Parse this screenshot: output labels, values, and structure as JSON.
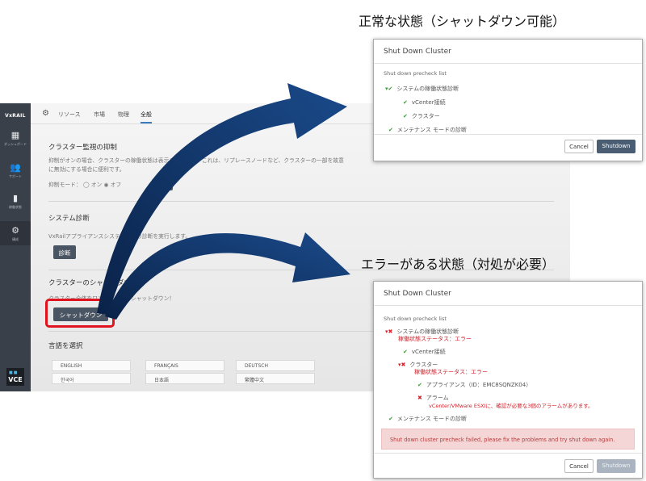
{
  "headings": {
    "normal": "正常な状態（シャットダウン可能）",
    "error": "エラーがある状態（対処が必要）"
  },
  "sidebar": {
    "logo": "VxRAIL",
    "items": [
      {
        "icon": "dashboard-icon",
        "label": "ダッシュボード"
      },
      {
        "icon": "support-icon",
        "label": "サポート"
      },
      {
        "icon": "health-icon",
        "label": "稼働状態"
      },
      {
        "icon": "config-icon",
        "label": "構成"
      }
    ],
    "vce": "VCE"
  },
  "tabs": [
    "リソース",
    "市場",
    "物理",
    "全般"
  ],
  "sections": {
    "suppress": {
      "title": "クラスター監視の抑制",
      "text": "抑制がオンの場合、クラスターの稼働状態は表示されません。これは、リプレースノードなど、クラスターの一部を故意",
      "text2": "に無効にする場合に便利です。",
      "mode_label": "抑制モード：",
      "on": "オン",
      "off": "オフ",
      "apply": "適用"
    },
    "diagnosis": {
      "title": "システム診断",
      "text": "VxRailアプライアンスシステム全体の診断を実行します。",
      "button": "診断"
    },
    "shutdown": {
      "title": "クラスターのシャットダウン",
      "text": "クラスター全体をワンクリックでシャットダウン！",
      "button": "シャットダウン"
    },
    "language": {
      "title": "言語を選択",
      "options": [
        "ENGLISH",
        "FRANÇAIS",
        "DEUTSCH",
        "한국어",
        "日本語",
        "繁體中文"
      ]
    }
  },
  "dialog_ok": {
    "title": "Shut Down Cluster",
    "precheck_label": "Shut down precheck list",
    "rows": [
      "システムの稼働状態診断",
      "vCenter接続",
      "クラスター",
      "メンテナンス モードの診断"
    ],
    "cancel": "Cancel",
    "shutdown": "Shutdown"
  },
  "dialog_err": {
    "title": "Shut Down Cluster",
    "precheck_label": "Shut down precheck list",
    "system_health": "システムの稼働状態診断",
    "system_health_status": "稼働状態ステータス：エラー",
    "vcenter": "vCenter接続",
    "cluster": "クラスター",
    "cluster_status": "稼働状態ステータス：エラー",
    "appliance": "アプライアンス（ID：EMC8SQNZK04）",
    "alarm": "アラーム",
    "alarm_detail": "vCenter/VMware ESXIに、確認が必要な3個のアラームがあります。",
    "maintenance": "メンテナンス モードの診断",
    "alert": "Shut down cluster precheck failed, please fix the problems and try shut down again.",
    "cancel": "Cancel",
    "shutdown": "Shutdown"
  },
  "colors": {
    "ok": "#3e9b3a",
    "error": "#d0202a",
    "highlight": "#e0141e",
    "arrow": "#0c2d5c"
  }
}
